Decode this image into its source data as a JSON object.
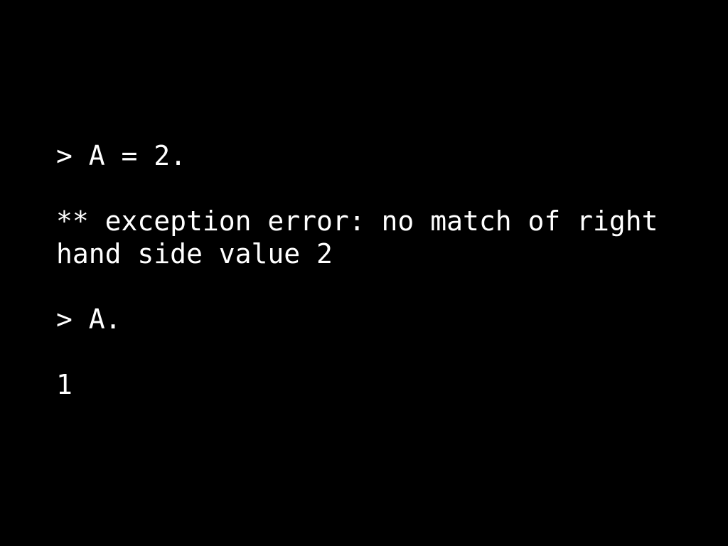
{
  "screen": {
    "background_color": "#000000",
    "foreground_color": "#ffffff",
    "kind": "terminal-session-slide"
  },
  "terminal": {
    "prompt_symbol": ">",
    "lines": [
      {
        "id": "input-1",
        "type": "input",
        "text": "> A = 2."
      },
      {
        "id": "blank-1",
        "type": "blank",
        "text": " "
      },
      {
        "id": "error-1",
        "type": "error",
        "text": "** exception error: no match of right"
      },
      {
        "id": "error-1-cont",
        "type": "error",
        "text": "hand side value 2"
      },
      {
        "id": "blank-2",
        "type": "blank",
        "text": " "
      },
      {
        "id": "input-2",
        "type": "input",
        "text": "> A."
      },
      {
        "id": "blank-3",
        "type": "blank",
        "text": " "
      },
      {
        "id": "output-1",
        "type": "output",
        "text": "1"
      }
    ]
  }
}
